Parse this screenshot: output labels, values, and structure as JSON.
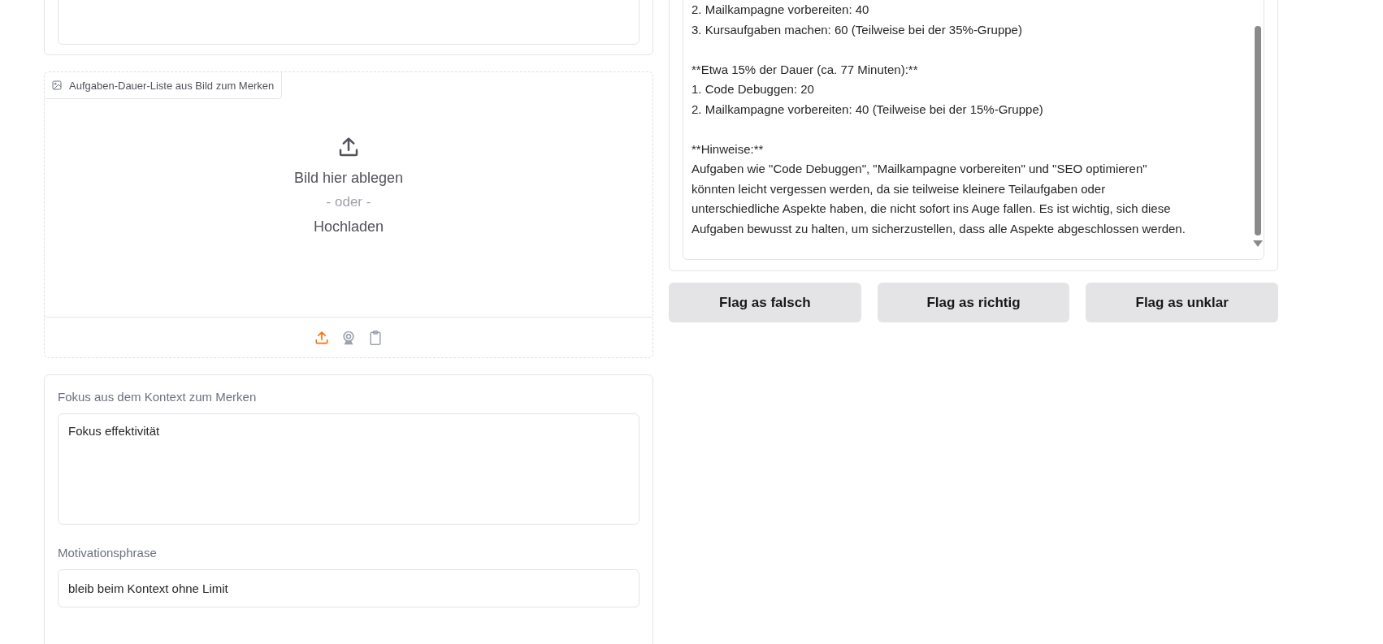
{
  "left": {
    "image_upload": {
      "label": "Aufgaben-Dauer-Liste aus Bild zum Merken",
      "drop_text": "Bild hier ablegen",
      "or_text": "- oder -",
      "upload_text": "Hochladen",
      "sources": [
        {
          "kind": "upload",
          "selected": true
        },
        {
          "kind": "webcam",
          "selected": false
        },
        {
          "kind": "clipboard",
          "selected": false
        }
      ]
    },
    "fields": [
      {
        "label": "Fokus aus dem Kontext zum Merken",
        "kind": "textarea",
        "value": "Fokus effektivität"
      },
      {
        "label": "Motivationsphrase",
        "kind": "input",
        "value": "bleib beim Kontext ohne Limit"
      }
    ]
  },
  "right": {
    "output_paragraphs": [
      [
        "2. Mailkampagne vorbereiten: 40",
        "3. Kursaufgaben machen: 60 (Teilweise bei der 35%-Gruppe)"
      ],
      [
        "**Etwa 15% der Dauer (ca. 77 Minuten):**",
        "1. Code Debuggen: 20",
        "2. Mailkampagne vorbereiten: 40 (Teilweise bei der 15%-Gruppe)"
      ],
      [
        "**Hinweise:**",
        "Aufgaben wie \"Code Debuggen\", \"Mailkampagne vorbereiten\" und \"SEO optimieren\"",
        "könnten leicht vergessen werden, da sie teilweise kleinere Teilaufgaben oder",
        "unterschiedliche Aspekte haben, die nicht sofort ins Auge fallen. Es ist wichtig, sich diese",
        "Aufgaben bewusst zu halten, um sicherzustellen, dass alle Aspekte abgeschlossen werden."
      ]
    ],
    "buttons": [
      "Flag as falsch",
      "Flag as richtig",
      "Flag as unklar"
    ]
  }
}
